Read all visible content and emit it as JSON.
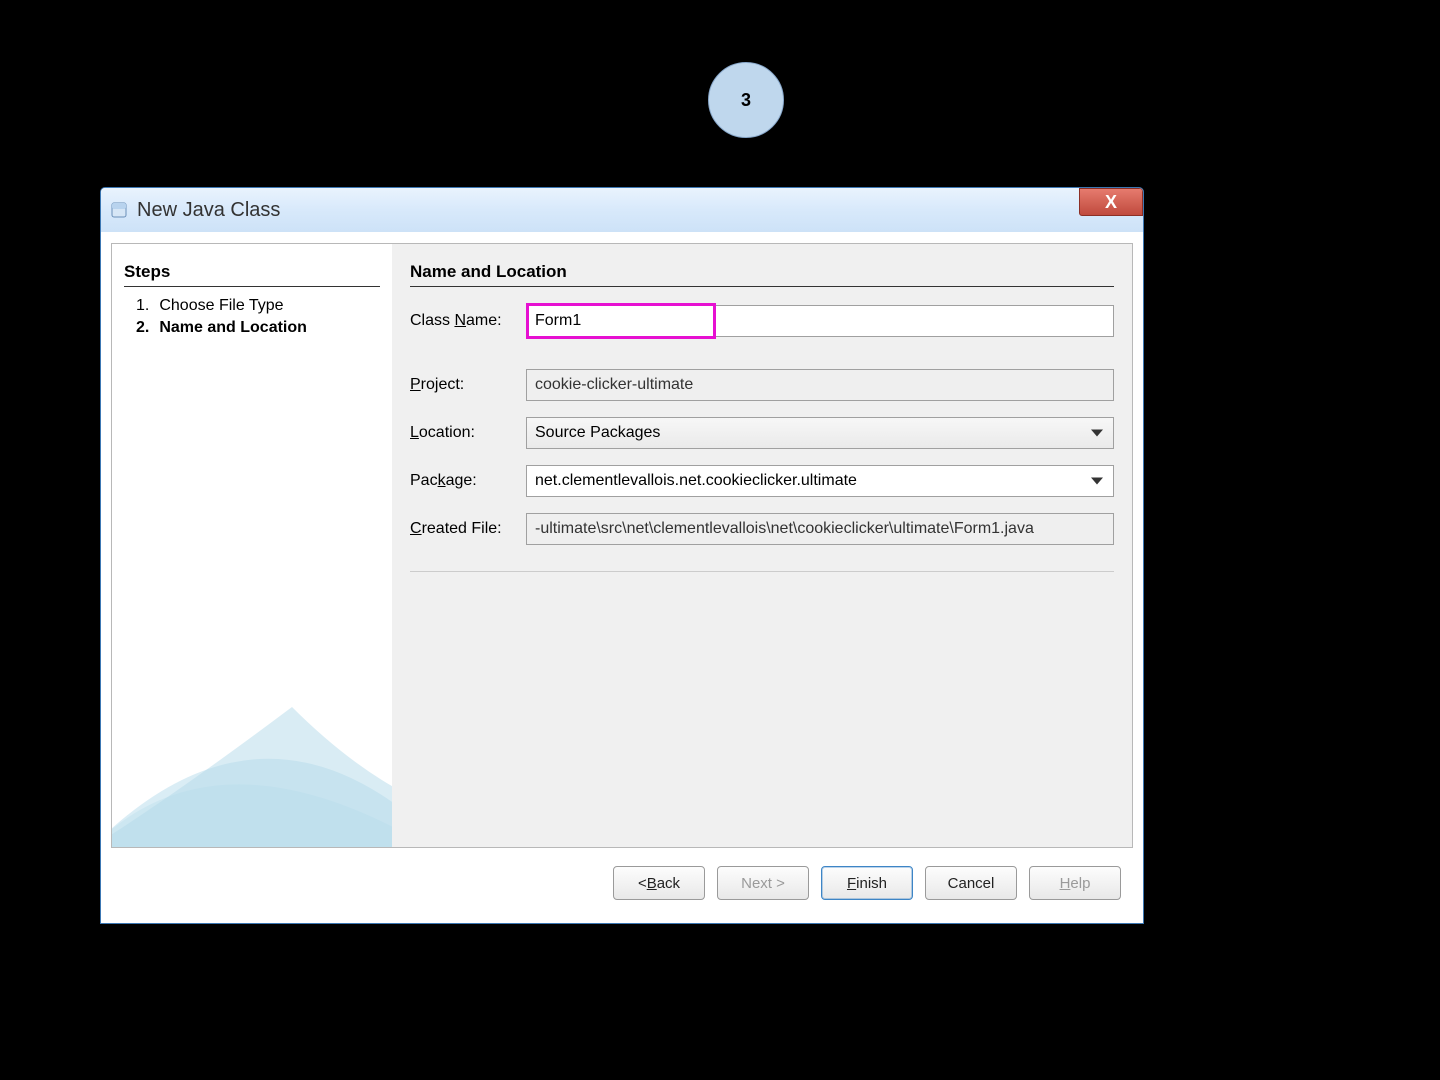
{
  "callout": {
    "number": "3"
  },
  "window": {
    "title": "New Java Class",
    "close_label": "X"
  },
  "steps": {
    "heading": "Steps",
    "items": [
      {
        "num": "1.",
        "label": "Choose File Type",
        "current": false
      },
      {
        "num": "2.",
        "label": "Name and Location",
        "current": true
      }
    ]
  },
  "panel": {
    "heading": "Name and Location",
    "class_name_label_pre": "Class ",
    "class_name_label_u": "N",
    "class_name_label_post": "ame:",
    "class_name_value": "Form1",
    "project_label_u": "P",
    "project_label_post": "roject:",
    "project_value": "cookie-clicker-ultimate",
    "location_label_u": "L",
    "location_label_post": "ocation:",
    "location_value": "Source Packages",
    "package_label_pre": "Pac",
    "package_label_u": "k",
    "package_label_post": "age:",
    "package_value": "net.clementlevallois.net.cookieclicker.ultimate",
    "created_label_u": "C",
    "created_label_post": "reated File:",
    "created_value": "-ultimate\\src\\net\\clementlevallois\\net\\cookieclicker\\ultimate\\Form1.java"
  },
  "buttons": {
    "back_pre": "< ",
    "back_u": "B",
    "back_post": "ack",
    "next": "Next >",
    "finish_u": "F",
    "finish_post": "inish",
    "cancel": "Cancel",
    "help_u": "H",
    "help_post": "elp"
  }
}
